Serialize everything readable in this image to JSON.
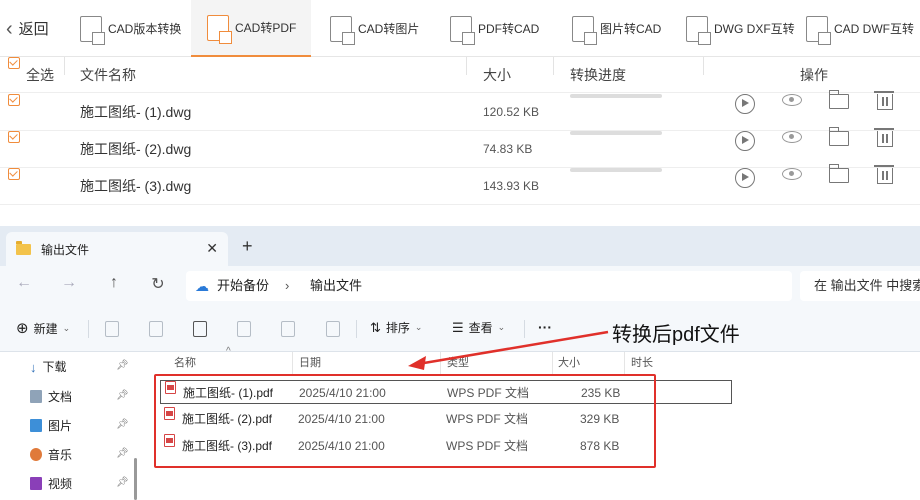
{
  "app": {
    "back_label": "返回",
    "tools": [
      {
        "label": "CAD版本转换",
        "active": false
      },
      {
        "label": "CAD转PDF",
        "active": true
      },
      {
        "label": "CAD转图片",
        "active": false
      },
      {
        "label": "PDF转CAD",
        "active": false
      },
      {
        "label": "图片转CAD",
        "active": false
      },
      {
        "label": "DWG DXF互转",
        "active": false
      },
      {
        "label": "CAD DWF互转",
        "active": false
      }
    ],
    "accent_color": "#f08c3c",
    "columns": {
      "select_all": "全选",
      "name": "文件名称",
      "size": "大小",
      "progress": "转换进度",
      "actions": "操作"
    },
    "files": [
      {
        "name": "施工图纸- (1).dwg",
        "size": "120.52 KB",
        "progress": 0,
        "checked": true
      },
      {
        "name": "施工图纸- (2).dwg",
        "size": "74.83 KB",
        "progress": 0,
        "checked": true
      },
      {
        "name": "施工图纸- (3).dwg",
        "size": "143.93 KB",
        "progress": 0,
        "checked": true
      }
    ],
    "row_action_icons": [
      "play-icon",
      "eye-icon",
      "folder-icon",
      "trash-icon"
    ]
  },
  "explorer": {
    "tab_title": "输出文件",
    "breadcrumb": [
      "开始备份",
      "输出文件"
    ],
    "search_placeholder": "在 输出文件 中搜索",
    "commands": {
      "new": "新建",
      "sort": "排序",
      "view": "查看",
      "more": "···"
    },
    "sidebar": [
      {
        "label": "下载",
        "icon": "download-icon"
      },
      {
        "label": "文档",
        "icon": "document-icon"
      },
      {
        "label": "图片",
        "icon": "picture-icon"
      },
      {
        "label": "音乐",
        "icon": "music-icon"
      },
      {
        "label": "视频",
        "icon": "video-icon"
      }
    ],
    "columns": {
      "name": "名称",
      "date": "日期",
      "type": "类型",
      "size": "大小",
      "duration": "时长"
    },
    "files": [
      {
        "name": "施工图纸- (1).pdf",
        "date": "2025/4/10 21:00",
        "type": "WPS PDF 文档",
        "size": "235 KB",
        "selected": true
      },
      {
        "name": "施工图纸- (2).pdf",
        "date": "2025/4/10 21:00",
        "type": "WPS PDF 文档",
        "size": "329 KB",
        "selected": false
      },
      {
        "name": "施工图纸- (3).pdf",
        "date": "2025/4/10 21:00",
        "type": "WPS PDF 文档",
        "size": "878 KB",
        "selected": false
      }
    ]
  },
  "annotation": {
    "text": "转换后pdf文件",
    "color": "#e0302a"
  }
}
